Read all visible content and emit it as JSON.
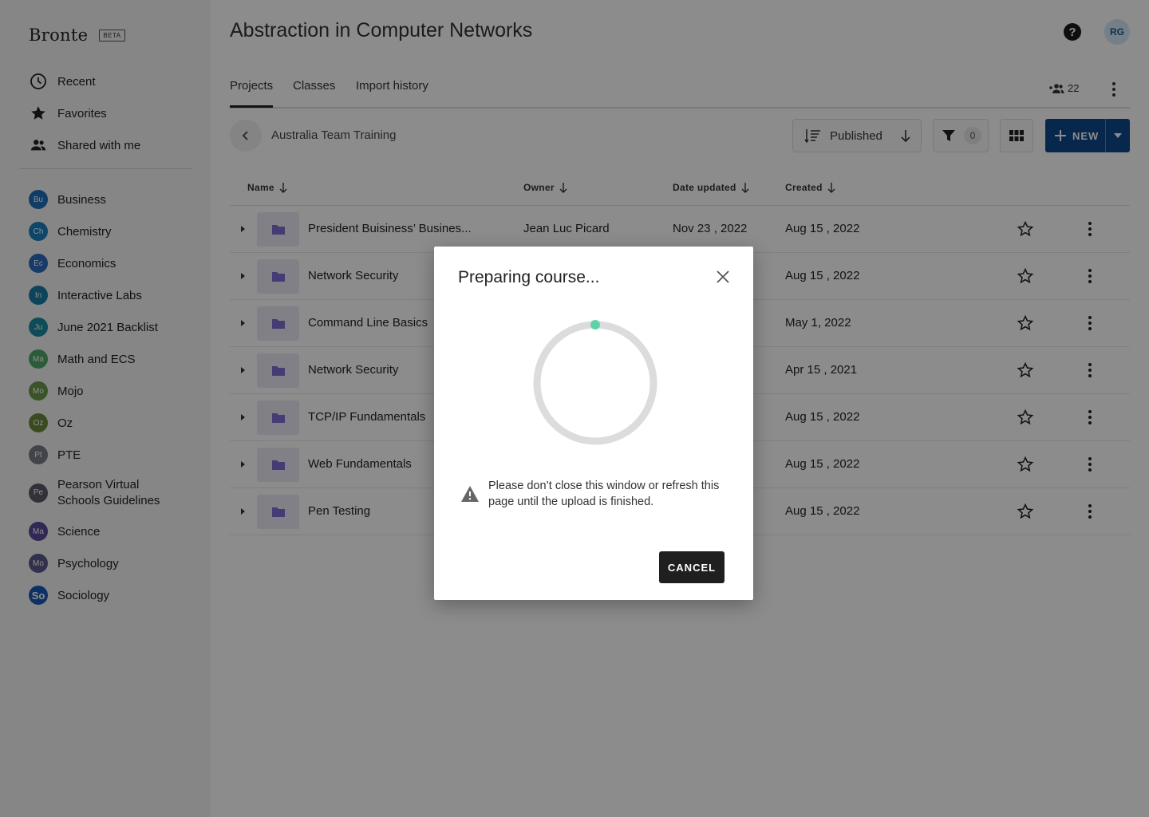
{
  "brand": {
    "name": "Bronte",
    "badge": "BETA"
  },
  "nav": [
    {
      "label": "Recent",
      "icon": "clock-icon"
    },
    {
      "label": "Favorites",
      "icon": "star-icon"
    },
    {
      "label": "Shared with me",
      "icon": "people-icon"
    }
  ],
  "classes": [
    {
      "abbr": "Bu",
      "label": "Business",
      "color": "#1e6fb8"
    },
    {
      "abbr": "Ch",
      "label": "Chemistry",
      "color": "#1a7ec2"
    },
    {
      "abbr": "Ec",
      "label": "Economics",
      "color": "#2a6ac0"
    },
    {
      "abbr": "In",
      "label": "Interactive Labs",
      "color": "#1a7aa8"
    },
    {
      "abbr": "Ju",
      "label": "June 2021 Backlist",
      "color": "#1a8aa0"
    },
    {
      "abbr": "Ma",
      "label": "Math and ECS",
      "color": "#4fa86a"
    },
    {
      "abbr": "Mo",
      "label": "Mojo",
      "color": "#6a9a4a"
    },
    {
      "abbr": "Oz",
      "label": "Oz",
      "color": "#6a8a3a"
    },
    {
      "abbr": "Pt",
      "label": "PTE",
      "color": "#7a7a8a"
    },
    {
      "abbr": "Pe",
      "label": "Pearson Virtual Schools Guidelines",
      "color": "#5a5a6a"
    },
    {
      "abbr": "Ma",
      "label": "Science",
      "color": "#5a4a9a"
    },
    {
      "abbr": "Mo",
      "label": "Psychology",
      "color": "#5a5a8a"
    },
    {
      "abbr": "So",
      "label": "Sociology",
      "color": "#1a5ab8"
    }
  ],
  "header": {
    "title": "Abstraction in Computer Networks",
    "avatar": "RG",
    "help": "?"
  },
  "tabs": [
    {
      "label": "Projects",
      "active": true
    },
    {
      "label": "Classes",
      "active": false
    },
    {
      "label": "Import history",
      "active": false
    }
  ],
  "members_count": "22",
  "breadcrumb": {
    "label": "Australia Team Training"
  },
  "toolbar": {
    "sort_label": "Published",
    "filter_count": "0",
    "new_label": "NEW"
  },
  "table": {
    "columns": {
      "name": "Name",
      "owner": "Owner",
      "updated": "Date updated",
      "created": "Created"
    },
    "rows": [
      {
        "name": "President Buisiness’ Busines...",
        "owner": "Jean Luc Picard",
        "updated": "Nov 23 , 2022",
        "created": "Aug 15 , 2022"
      },
      {
        "name": "Network Security",
        "owner": "",
        "updated": "",
        "created": "Aug 15 , 2022"
      },
      {
        "name": "Command Line Basics",
        "owner": "",
        "updated": "",
        "created": "May 1, 2022"
      },
      {
        "name": "Network Security",
        "owner": "",
        "updated": "",
        "created": "Apr 15 , 2021"
      },
      {
        "name": "TCP/IP Fundamentals",
        "owner": "",
        "updated": "",
        "created": "Aug 15 , 2022"
      },
      {
        "name": "Web Fundamentals",
        "owner": "",
        "updated": "",
        "created": "Aug 15 , 2022"
      },
      {
        "name": "Pen Testing",
        "owner": "",
        "updated": "",
        "created": "Aug 15 , 2022"
      }
    ]
  },
  "modal": {
    "title": "Preparing course...",
    "warning": "Please don’t close this window or refresh this page until the upload is finished.",
    "cancel_label": "CANCEL",
    "progress_color": "#5fd3a8"
  }
}
